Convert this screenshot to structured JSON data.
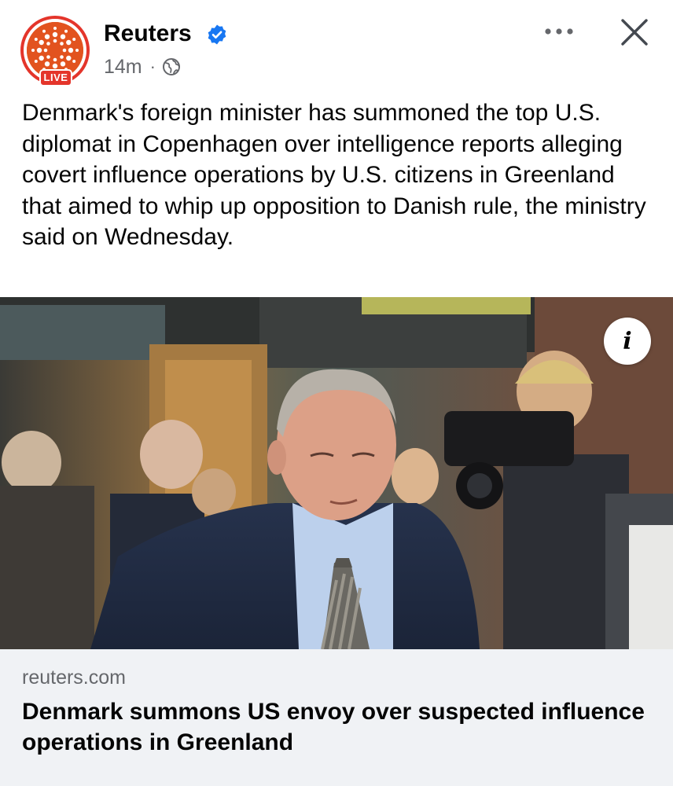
{
  "post": {
    "author": "Reuters",
    "live_badge": "LIVE",
    "time": "14m",
    "separator": "·",
    "audience_icon": "globe-icon",
    "verified_icon": "verified-badge-icon",
    "text": "Denmark's foreign minister has summoned the top U.S. diplomat in Copenhagen over intelligence reports alleging covert influence operations by U.S. citizens in Greenland that aimed to whip up opposition to Danish rule, the ministry said on Wednesday."
  },
  "actions": {
    "more_icon": "more-horizontal-icon",
    "close_icon": "close-icon",
    "info_label": "i"
  },
  "link_preview": {
    "domain": "reuters.com",
    "title": "Denmark summons US envoy over suspected influence operations in Greenland"
  },
  "colors": {
    "brand_orange": "#e2531f",
    "live_red": "#e4352b",
    "verified_blue": "#1877f2",
    "meta_gray": "#65676b",
    "card_bg": "#f0f2f5"
  }
}
